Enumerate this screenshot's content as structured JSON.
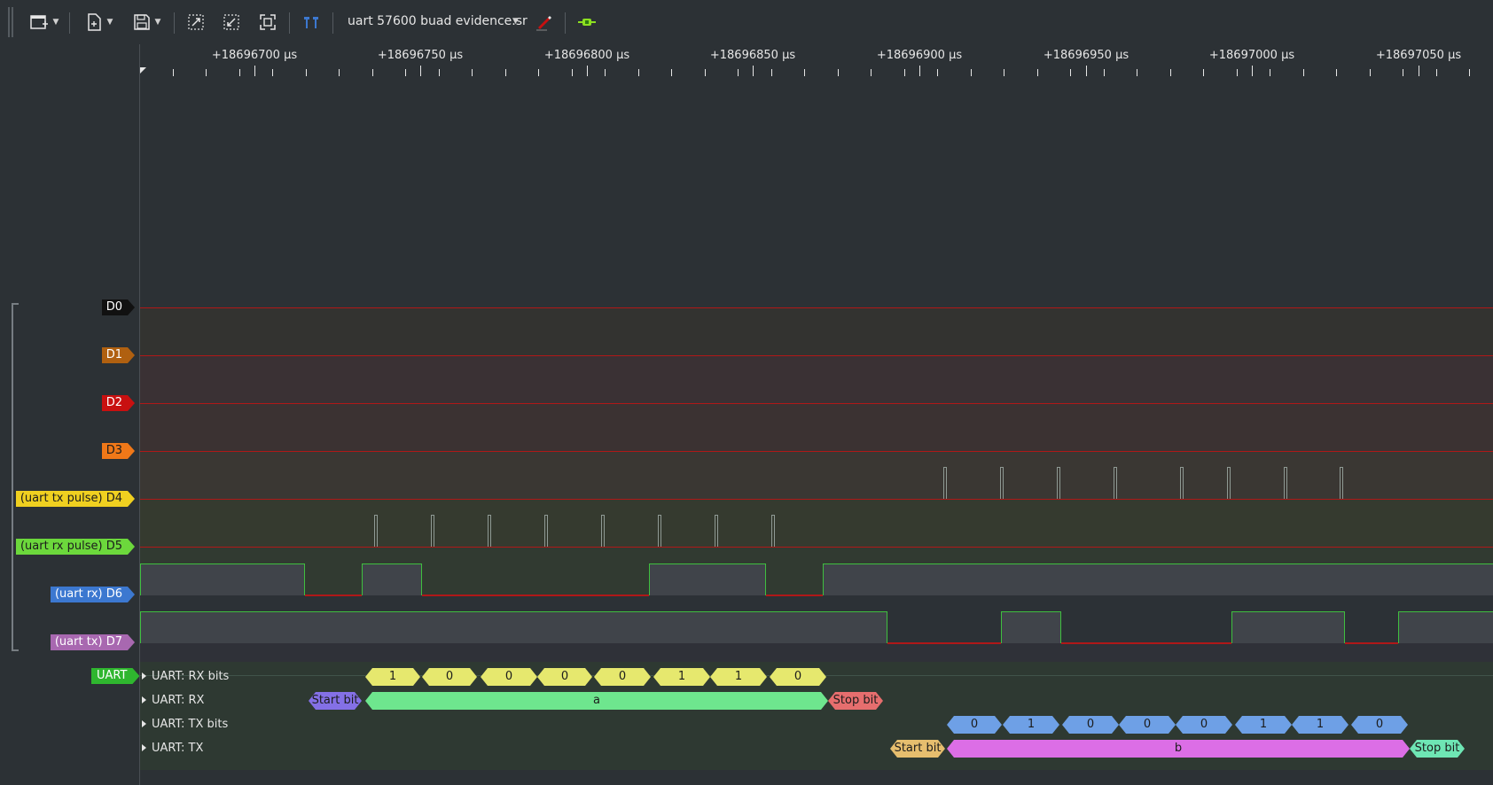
{
  "toolbar": {
    "file_name": "uart 57600 buad evidence.sr",
    "icons": [
      "new-view-icon",
      "open-file-icon",
      "save-icon",
      "zoom-fit-icon",
      "zoom-one-to-one-icon",
      "zoom-extents-icon",
      "cursor-icon",
      "decoder-icon",
      "add-probe-icon"
    ]
  },
  "ruler": {
    "labels": [
      "+18696700 µs",
      "+18696750 µs",
      "+18696800 µs",
      "+18696850 µs",
      "+18696900 µs",
      "+18696950 µs",
      "+18697000 µs",
      "+18697050 µs"
    ]
  },
  "channels": [
    {
      "label": "D0",
      "color": "#111111",
      "text_color": "#ffffff"
    },
    {
      "label": "D1",
      "color": "#b06010",
      "text_color": "#ffffff"
    },
    {
      "label": "D2",
      "color": "#c81010",
      "text_color": "#ffffff"
    },
    {
      "label": "D3",
      "color": "#f07818",
      "text_color": "#1c1c1c"
    },
    {
      "label": "(uart tx pulse) D4",
      "color": "#f0d020",
      "text_color": "#1c1c1c"
    },
    {
      "label": "(uart rx pulse) D5",
      "color": "#6cd83c",
      "text_color": "#1c1c1c"
    },
    {
      "label": "(uart rx) D6",
      "color": "#3c78d0",
      "text_color": "#ffffff"
    },
    {
      "label": "(uart tx) D7",
      "color": "#a868b0",
      "text_color": "#ffffff"
    }
  ],
  "decoder": {
    "name": "UART",
    "rows": [
      "UART: RX bits",
      "UART: RX",
      "UART: TX bits",
      "UART: TX"
    ],
    "rx_bits": [
      "1",
      "0",
      "0",
      "0",
      "0",
      "1",
      "1",
      "0"
    ],
    "rx_start": "Start bit",
    "rx_data": "a",
    "rx_stop": "Stop bit",
    "tx_bits": [
      "0",
      "1",
      "0",
      "0",
      "0",
      "1",
      "1",
      "0"
    ],
    "tx_start": "Start bit",
    "tx_data": "b",
    "tx_stop": "Stop bit"
  }
}
